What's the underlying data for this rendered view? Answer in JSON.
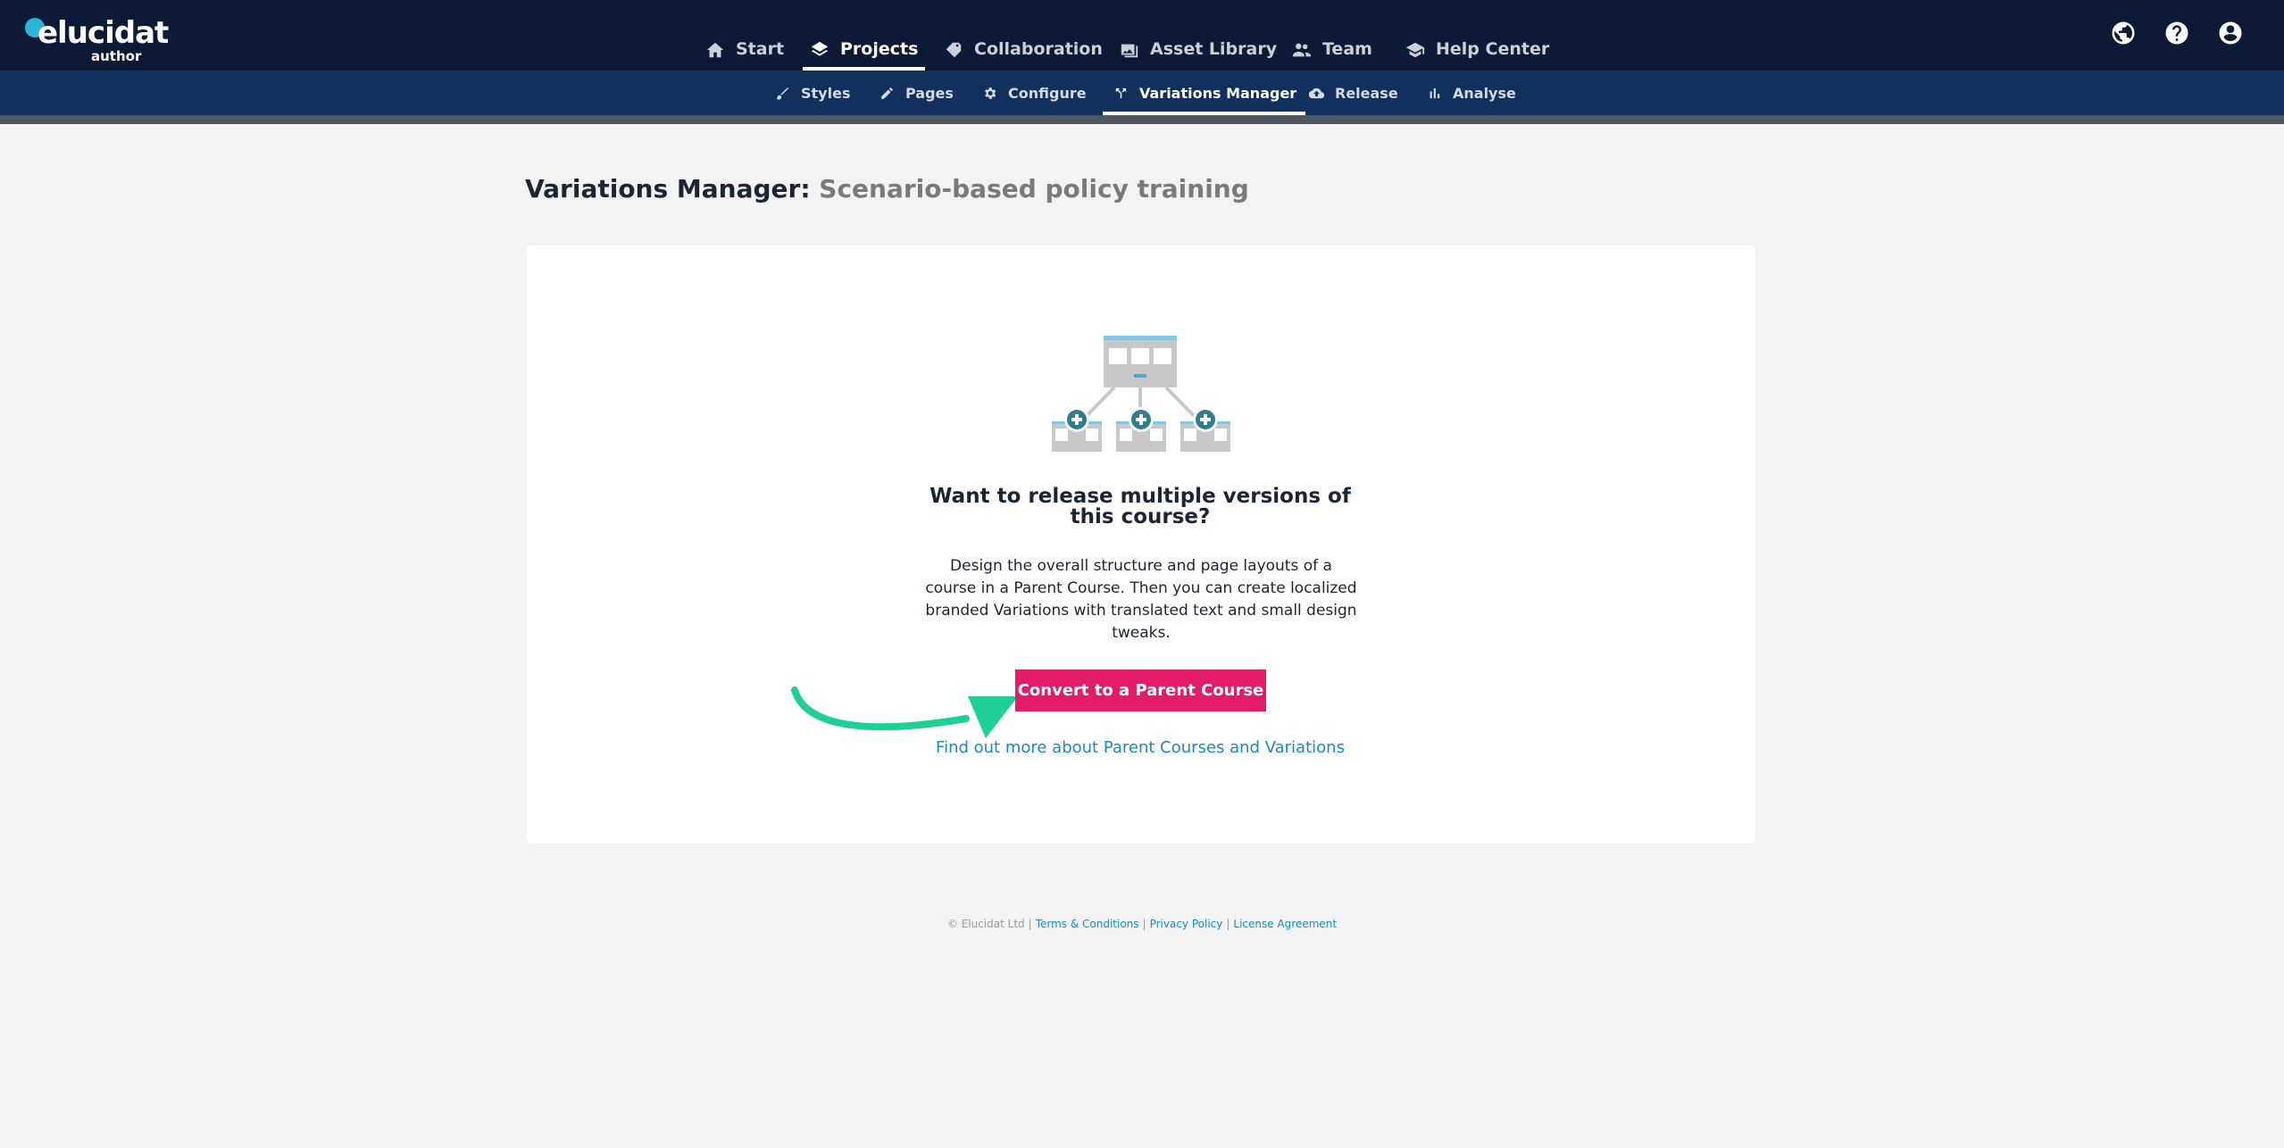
{
  "app": {
    "logo_text": "elucidat",
    "logo_subtext": "author"
  },
  "main_nav": [
    {
      "label": "Start",
      "icon": "home-icon"
    },
    {
      "label": "Projects",
      "icon": "layers-icon",
      "active": true
    },
    {
      "label": "Collaboration",
      "icon": "tag-icon"
    },
    {
      "label": "Asset Library",
      "icon": "images-icon"
    },
    {
      "label": "Team",
      "icon": "team-icon"
    },
    {
      "label": "Help Center",
      "icon": "graduation-cap-icon"
    }
  ],
  "top_icons": [
    "globe-icon",
    "help-icon",
    "account-icon"
  ],
  "sub_nav": [
    {
      "label": "Styles",
      "icon": "brush-icon"
    },
    {
      "label": "Pages",
      "icon": "pencil-icon"
    },
    {
      "label": "Configure",
      "icon": "gear-icon"
    },
    {
      "label": "Variations Manager",
      "icon": "fork-icon",
      "active": true
    },
    {
      "label": "Release",
      "icon": "cloud-upload-icon"
    },
    {
      "label": "Analyse",
      "icon": "bar-chart-icon"
    }
  ],
  "page": {
    "title_prefix": "Variations Manager:",
    "course_name": "Scenario-based policy training"
  },
  "empty_state": {
    "illustration": "parent-course-variations-illustration",
    "headline": "Want to release multiple versions of this course?",
    "description": "Design the overall structure and page layouts of a course in a Parent Course. Then you can create localized branded Variations with translated text and small design tweaks.",
    "cta_label": "Convert to a Parent Course",
    "learn_more_link": "Find out more about Parent Courses and Variations"
  },
  "footer": {
    "copyright": "© Elucidat Ltd",
    "links": [
      "Terms & Conditions",
      "Privacy Policy",
      "License Agreement"
    ]
  },
  "colors": {
    "topbar": "#0d1a36",
    "subbar": "#12305c",
    "cta": "#e41b67",
    "link": "#1a88c9",
    "arrow": "#1fcf98"
  }
}
